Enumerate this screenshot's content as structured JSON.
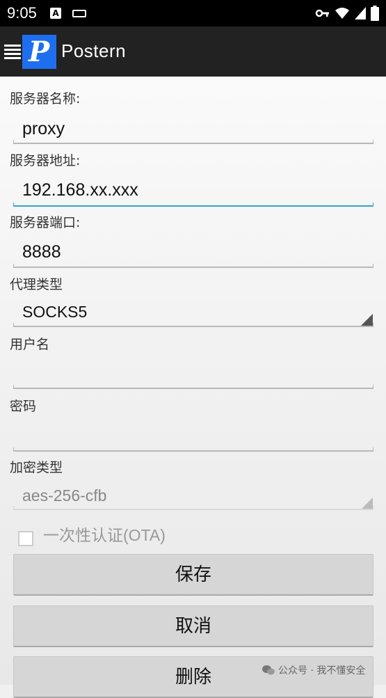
{
  "status_bar": {
    "time": "9:05",
    "notification_letter": "A",
    "icons": [
      "notification-a-icon",
      "keyboard-icon",
      "vpn-key-icon",
      "wifi-icon",
      "signal-icon",
      "battery-icon"
    ]
  },
  "app_bar": {
    "title": "Postern",
    "logo_letter": "P",
    "brand_color": "#1e6ff0"
  },
  "form": {
    "server_name": {
      "label": "服务器名称:",
      "value": "proxy"
    },
    "server_address": {
      "label": "服务器地址:",
      "value": "192.168.xx.xxx",
      "focused": true
    },
    "server_port": {
      "label": "服务器端口:",
      "value": "8888"
    },
    "proxy_type": {
      "label": "代理类型",
      "value": "SOCKS5"
    },
    "username": {
      "label": "用户名",
      "value": ""
    },
    "password": {
      "label": "密码",
      "value": ""
    },
    "encryption_type": {
      "label": "加密类型",
      "value": "aes-256-cfb",
      "enabled": false
    },
    "ota": {
      "label": "一次性认证(OTA)",
      "checked": false,
      "enabled": false
    }
  },
  "buttons": {
    "save": "保存",
    "cancel": "取消",
    "delete": "删除"
  },
  "watermark": "公众号 · 我不懂安全",
  "accent_color": "#33a3d9"
}
